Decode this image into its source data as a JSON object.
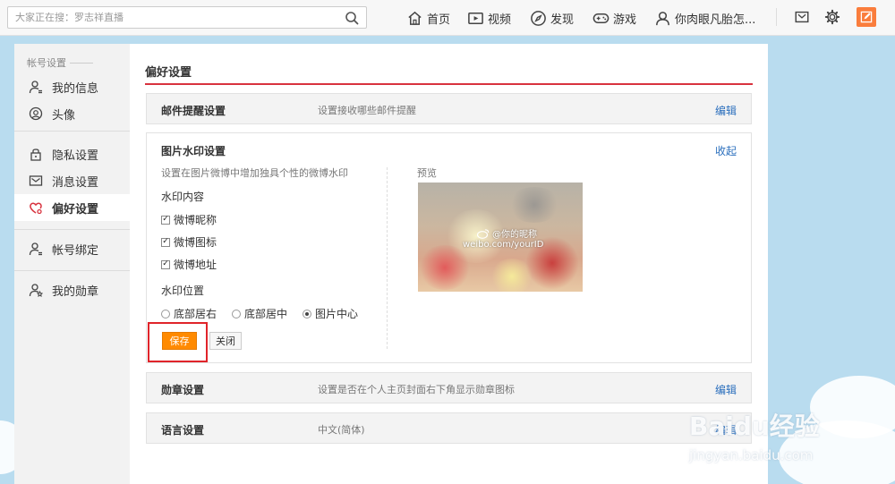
{
  "topbar": {
    "search_placeholder": "大家正在搜：罗志祥直播",
    "nav": [
      {
        "label": "首页",
        "icon": "home-icon"
      },
      {
        "label": "视频",
        "icon": "video-icon"
      },
      {
        "label": "发现",
        "icon": "compass-icon"
      },
      {
        "label": "游戏",
        "icon": "gamepad-icon"
      },
      {
        "label": "你肉眼凡胎怎...",
        "icon": "user-icon"
      }
    ],
    "tools": [
      "mail-icon",
      "gear-icon",
      "compose-icon"
    ],
    "accent": "#fa7d3c"
  },
  "sidebar": {
    "group_label": "帐号设置",
    "items": [
      {
        "label": "我的信息",
        "icon": "user-info-icon"
      },
      {
        "label": "头像",
        "icon": "avatar-icon"
      },
      {
        "label": "隐私设置",
        "icon": "lock-icon"
      },
      {
        "label": "消息设置",
        "icon": "message-icon"
      },
      {
        "label": "偏好设置",
        "icon": "heart-gear-icon",
        "active": true
      },
      {
        "label": "帐号绑定",
        "icon": "account-bind-icon"
      },
      {
        "label": "我的勋章",
        "icon": "medal-icon"
      }
    ]
  },
  "main": {
    "title": "偏好设置",
    "accent": "#d8333f",
    "email": {
      "title": "邮件提醒设置",
      "desc": "设置接收哪些邮件提醒",
      "action": "编辑"
    },
    "watermark": {
      "title": "图片水印设置",
      "action": "收起",
      "desc": "设置在图片微博中增加独具个性的微博水印",
      "content_label": "水印内容",
      "options": [
        {
          "label": "微博昵称",
          "checked": true
        },
        {
          "label": "微博图标",
          "checked": true
        },
        {
          "label": "微博地址",
          "checked": true
        }
      ],
      "position_label": "水印位置",
      "positions": [
        {
          "label": "底部居右",
          "selected": false
        },
        {
          "label": "底部居中",
          "selected": false
        },
        {
          "label": "图片中心",
          "selected": true
        }
      ],
      "save_label": "保存",
      "close_label": "关闭",
      "preview_label": "预览",
      "preview_name": "@你的昵称",
      "preview_url": "weibo.com/yourID"
    },
    "medal": {
      "title": "勋章设置",
      "desc": "设置是否在个人主页封面右下角显示勋章图标",
      "action": "编辑"
    },
    "language": {
      "title": "语言设置",
      "desc": "中文(简体)",
      "action": "编辑"
    }
  },
  "watermark_overlay": {
    "brand": "Baidu经验",
    "url": "jingyan.baidu.com"
  }
}
